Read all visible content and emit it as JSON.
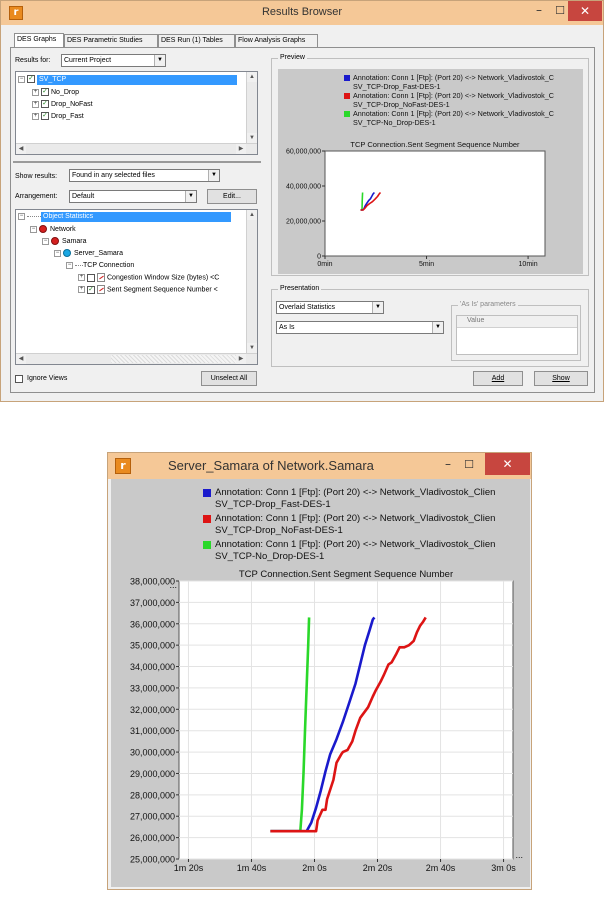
{
  "results_browser": {
    "title": "Results Browser",
    "tabs": [
      {
        "label": "DES Graphs",
        "active": true
      },
      {
        "label": "DES Parametric Studies",
        "active": false
      },
      {
        "label": "DES Run (1) Tables",
        "active": false
      },
      {
        "label": "Flow Analysis Graphs",
        "active": false
      }
    ],
    "results_for_label": "Results for:",
    "results_for_value": "Current Project",
    "project_tree": [
      {
        "label": "SV_TCP",
        "level": 0,
        "selected": true
      },
      {
        "label": "No_Drop",
        "level": 1,
        "selected": false
      },
      {
        "label": "Drop_NoFast",
        "level": 1,
        "selected": false
      },
      {
        "label": "Drop_Fast",
        "level": 1,
        "selected": false
      }
    ],
    "show_results_label": "Show results:",
    "show_results_value": "Found in any selected files",
    "arrangement_label": "Arrangement:",
    "arrangement_value": "Default",
    "edit_button": "Edit...",
    "object_tree": [
      {
        "label": "Object Statistics",
        "icon": "tree-root",
        "selected": true
      },
      {
        "label": "Network",
        "icon": "network",
        "selected": false
      },
      {
        "label": "Samara",
        "icon": "subnet",
        "selected": false
      },
      {
        "label": "Server_Samara",
        "icon": "server",
        "selected": false
      },
      {
        "label": "TCP Connection",
        "icon": "folder",
        "selected": false
      },
      {
        "label": "Congestion Window Size (bytes) <C",
        "icon": "stat",
        "checked": false
      },
      {
        "label": "Sent Segment Sequence Number <",
        "icon": "stat",
        "checked": true
      }
    ],
    "ignore_views_label": "Ignore Views",
    "unselect_all_button": "Unselect All",
    "preview_group": "Preview",
    "presentation_group": "Presentation",
    "presentation_value": "Overlaid Statistics",
    "as_is_value": "As Is",
    "as_is_params_group": "'As Is' parameters",
    "value_column": "Value",
    "add_button": "Add",
    "show_button": "Show"
  },
  "graph_window": {
    "title": "Server_Samara of Network.Samara"
  },
  "colors": {
    "blue": "#1a1acc",
    "red": "#dd1414",
    "green": "#2ad82a",
    "title_bar": "#f5c897",
    "close_button": "#c7463f",
    "plot_frame": "#c9c9c9"
  },
  "chart_data": [
    {
      "type": "line",
      "chart": "preview",
      "title": "TCP Connection.Sent Segment Sequence Number",
      "legend": [
        {
          "color": "blue",
          "lines": [
            "Annotation: Conn 1 [Ftp]: (Port 20) <-> Network_Vladivostok_C",
            "SV_TCP-Drop_Fast-DES-1"
          ]
        },
        {
          "color": "red",
          "lines": [
            "Annotation: Conn 1 [Ftp]: (Port 20) <-> Network_Vladivostok_C",
            "SV_TCP-Drop_NoFast-DES-1"
          ]
        },
        {
          "color": "green",
          "lines": [
            "Annotation: Conn 1 [Ftp]: (Port 20) <-> Network_Vladivostok_C",
            "SV_TCP-No_Drop-DES-1"
          ]
        }
      ],
      "y_ticks": [
        {
          "v": 0,
          "label": "0"
        },
        {
          "v": 20000000,
          "label": "20,000,000"
        },
        {
          "v": 40000000,
          "label": "40,000,000"
        },
        {
          "v": 60000000,
          "label": "60,000,000"
        }
      ],
      "x_ticks": [
        {
          "v": 0,
          "label": "0min"
        },
        {
          "v": 300,
          "label": "5min"
        },
        {
          "v": 600,
          "label": "10min"
        }
      ],
      "xlim": [
        0,
        650
      ],
      "ylim": [
        0,
        60000000
      ],
      "series": [
        {
          "color": "green",
          "x": [
            105,
            109,
            109.5,
            110,
            110.5,
            111
          ],
          "y": [
            26300000,
            26300000,
            28000000,
            31000000,
            34000000,
            36300000
          ]
        },
        {
          "color": "blue",
          "x": [
            105,
            111,
            115,
            119,
            124,
            129,
            134,
            138,
            142,
            146
          ],
          "y": [
            26300000,
            26300000,
            27000000,
            28800000,
            30300000,
            31700000,
            32700000,
            34000000,
            35500000,
            36300000
          ]
        },
        {
          "color": "red",
          "x": [
            105,
            113,
            118,
            125,
            132,
            140,
            148,
            155,
            160,
            164
          ],
          "y": [
            26300000,
            26300000,
            27300000,
            29000000,
            30000000,
            31000000,
            32500000,
            34000000,
            35500000,
            36300000
          ]
        }
      ]
    },
    {
      "type": "line",
      "chart": "main",
      "title": "TCP Connection.Sent Segment Sequence Number",
      "legend": [
        {
          "color": "blue",
          "lines": [
            "Annotation: Conn 1 [Ftp]: (Port 20) <-> Network_Vladivostok_Clien",
            "SV_TCP-Drop_Fast-DES-1"
          ]
        },
        {
          "color": "red",
          "lines": [
            "Annotation: Conn 1 [Ftp]: (Port 20) <-> Network_Vladivostok_Clien",
            "SV_TCP-Drop_NoFast-DES-1"
          ]
        },
        {
          "color": "green",
          "lines": [
            "Annotation: Conn 1 [Ftp]: (Port 20) <-> Network_Vladivostok_Clien",
            "SV_TCP-No_Drop-DES-1"
          ]
        }
      ],
      "y_ticks": [
        {
          "v": 25000000,
          "label": "25,000,000"
        },
        {
          "v": 26000000,
          "label": "26,000,000"
        },
        {
          "v": 27000000,
          "label": "27,000,000"
        },
        {
          "v": 28000000,
          "label": "28,000,000"
        },
        {
          "v": 29000000,
          "label": "29,000,000"
        },
        {
          "v": 30000000,
          "label": "30,000,000"
        },
        {
          "v": 31000000,
          "label": "31,000,000"
        },
        {
          "v": 32000000,
          "label": "32,000,000"
        },
        {
          "v": 33000000,
          "label": "33,000,000"
        },
        {
          "v": 34000000,
          "label": "34,000,000"
        },
        {
          "v": 35000000,
          "label": "35,000,000"
        },
        {
          "v": 36000000,
          "label": "36,000,000"
        },
        {
          "v": 37000000,
          "label": "37,000,000"
        },
        {
          "v": 38000000,
          "label": "38,000,000"
        }
      ],
      "x_ticks": [
        {
          "v": 80,
          "label": "1m 20s"
        },
        {
          "v": 100,
          "label": "1m 40s"
        },
        {
          "v": 120,
          "label": "2m 0s"
        },
        {
          "v": 140,
          "label": "2m 20s"
        },
        {
          "v": 160,
          "label": "2m 40s"
        },
        {
          "v": 180,
          "label": "3m 0s"
        }
      ],
      "xlim": [
        77,
        183
      ],
      "ylim": [
        25000000,
        38000000
      ],
      "ellipsis": "...",
      "series": [
        {
          "color": "green",
          "x": [
            106,
            115.5,
            116,
            116.5,
            117,
            117.5,
            118,
            118.3
          ],
          "y": [
            26300000,
            26300000,
            27300000,
            29000000,
            31000000,
            33000000,
            35000000,
            36300000
          ]
        },
        {
          "color": "blue",
          "x": [
            106,
            117.5,
            119,
            120.5,
            122,
            123.5,
            125,
            127,
            129,
            131,
            133,
            134.5,
            136,
            137.5,
            138.5,
            139
          ],
          "y": [
            26300000,
            26300000,
            26700000,
            27400000,
            28200000,
            29100000,
            29900000,
            30600000,
            31400000,
            32300000,
            33200000,
            34100000,
            35000000,
            35700000,
            36200000,
            36300000
          ]
        },
        {
          "color": "red",
          "x": [
            106,
            119,
            120.5,
            121,
            122.5,
            123.5,
            124,
            126,
            127,
            128.5,
            129,
            130.5,
            132,
            133,
            134.5,
            135,
            137,
            138.5,
            139.5,
            141,
            142,
            143.5,
            144.5,
            146,
            147,
            148.5,
            150,
            151.5,
            152.5,
            153.5,
            154.5,
            155.3
          ],
          "y": [
            26300000,
            26300000,
            26300000,
            26800000,
            27300000,
            27300000,
            27800000,
            28700000,
            29500000,
            29900000,
            30000000,
            30100000,
            30500000,
            31000000,
            31600000,
            31700000,
            32100000,
            32600000,
            32900000,
            33300000,
            33600000,
            34100000,
            34200000,
            34600000,
            34900000,
            34900000,
            35000000,
            35200000,
            35600000,
            35900000,
            36100000,
            36300000
          ]
        }
      ]
    }
  ]
}
